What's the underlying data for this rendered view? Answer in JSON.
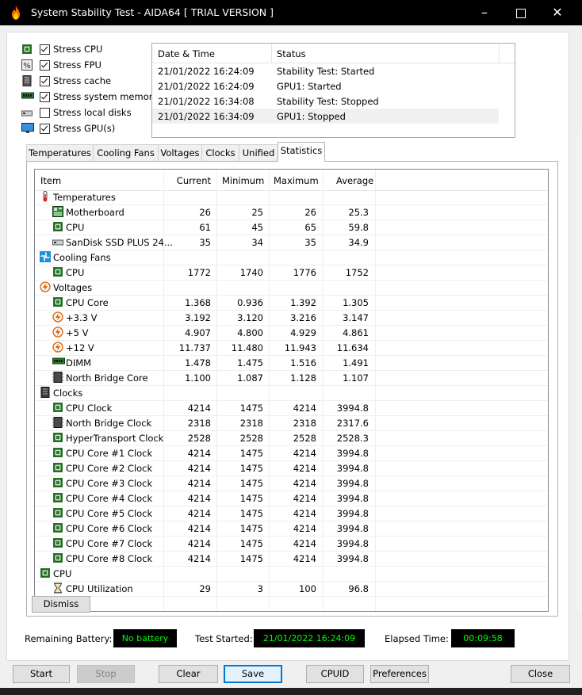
{
  "window": {
    "title": "System Stability Test - AIDA64  [ TRIAL VERSION ]"
  },
  "stress_options": [
    {
      "label": "Stress CPU",
      "checked": true,
      "icon": "cpu-chip-icon"
    },
    {
      "label": "Stress FPU",
      "checked": true,
      "icon": "fpu-percent-icon"
    },
    {
      "label": "Stress cache",
      "checked": true,
      "icon": "cache-icon"
    },
    {
      "label": "Stress system memory",
      "checked": true,
      "icon": "memory-icon"
    },
    {
      "label": "Stress local disks",
      "checked": false,
      "icon": "disk-icon"
    },
    {
      "label": "Stress GPU(s)",
      "checked": true,
      "icon": "monitor-icon"
    }
  ],
  "log": {
    "columns": [
      "Date & Time",
      "Status"
    ],
    "rows": [
      {
        "time": "21/01/2022 16:24:09",
        "status": "Stability Test: Started"
      },
      {
        "time": "21/01/2022 16:24:09",
        "status": "GPU1: Started"
      },
      {
        "time": "21/01/2022 16:34:08",
        "status": "Stability Test: Stopped"
      },
      {
        "time": "21/01/2022 16:34:09",
        "status": "GPU1: Stopped"
      }
    ]
  },
  "tabs": [
    "Temperatures",
    "Cooling Fans",
    "Voltages",
    "Clocks",
    "Unified",
    "Statistics"
  ],
  "active_tab": "Statistics",
  "stats": {
    "columns": [
      "Item",
      "Current",
      "Minimum",
      "Maximum",
      "Average"
    ],
    "rows": [
      {
        "type": "group",
        "name": "Temperatures",
        "icon": "thermometer-icon"
      },
      {
        "type": "item",
        "name": "Motherboard",
        "icon": "motherboard-icon",
        "current": "26",
        "minimum": "25",
        "maximum": "26",
        "average": "25.3"
      },
      {
        "type": "item",
        "name": "CPU",
        "icon": "cpu-chip-icon",
        "current": "61",
        "minimum": "45",
        "maximum": "65",
        "average": "59.8"
      },
      {
        "type": "item",
        "name": "SanDisk SSD PLUS 24...",
        "icon": "disk-icon",
        "current": "35",
        "minimum": "34",
        "maximum": "35",
        "average": "34.9"
      },
      {
        "type": "group",
        "name": "Cooling Fans",
        "icon": "fan-icon"
      },
      {
        "type": "item",
        "name": "CPU",
        "icon": "cpu-chip-icon",
        "current": "1772",
        "minimum": "1740",
        "maximum": "1776",
        "average": "1752"
      },
      {
        "type": "group",
        "name": "Voltages",
        "icon": "voltage-icon"
      },
      {
        "type": "item",
        "name": "CPU Core",
        "icon": "cpu-chip-icon",
        "current": "1.368",
        "minimum": "0.936",
        "maximum": "1.392",
        "average": "1.305"
      },
      {
        "type": "item",
        "name": "+3.3 V",
        "icon": "voltage-icon",
        "current": "3.192",
        "minimum": "3.120",
        "maximum": "3.216",
        "average": "3.147"
      },
      {
        "type": "item",
        "name": "+5 V",
        "icon": "voltage-icon",
        "current": "4.907",
        "minimum": "4.800",
        "maximum": "4.929",
        "average": "4.861"
      },
      {
        "type": "item",
        "name": "+12 V",
        "icon": "voltage-icon",
        "current": "11.737",
        "minimum": "11.480",
        "maximum": "11.943",
        "average": "11.634"
      },
      {
        "type": "item",
        "name": "DIMM",
        "icon": "memory-icon",
        "current": "1.478",
        "minimum": "1.475",
        "maximum": "1.516",
        "average": "1.491"
      },
      {
        "type": "item",
        "name": "North Bridge Core",
        "icon": "chipset-icon",
        "current": "1.100",
        "minimum": "1.087",
        "maximum": "1.128",
        "average": "1.107"
      },
      {
        "type": "group",
        "name": "Clocks",
        "icon": "clock-chip-icon"
      },
      {
        "type": "item",
        "name": "CPU Clock",
        "icon": "cpu-chip-icon",
        "current": "4214",
        "minimum": "1475",
        "maximum": "4214",
        "average": "3994.8"
      },
      {
        "type": "item",
        "name": "North Bridge Clock",
        "icon": "chipset-icon",
        "current": "2318",
        "minimum": "2318",
        "maximum": "2318",
        "average": "2317.6"
      },
      {
        "type": "item",
        "name": "HyperTransport Clock",
        "icon": "cpu-chip-icon",
        "current": "2528",
        "minimum": "2528",
        "maximum": "2528",
        "average": "2528.3"
      },
      {
        "type": "item",
        "name": "CPU Core #1 Clock",
        "icon": "cpu-chip-icon",
        "current": "4214",
        "minimum": "1475",
        "maximum": "4214",
        "average": "3994.8"
      },
      {
        "type": "item",
        "name": "CPU Core #2 Clock",
        "icon": "cpu-chip-icon",
        "current": "4214",
        "minimum": "1475",
        "maximum": "4214",
        "average": "3994.8"
      },
      {
        "type": "item",
        "name": "CPU Core #3 Clock",
        "icon": "cpu-chip-icon",
        "current": "4214",
        "minimum": "1475",
        "maximum": "4214",
        "average": "3994.8"
      },
      {
        "type": "item",
        "name": "CPU Core #4 Clock",
        "icon": "cpu-chip-icon",
        "current": "4214",
        "minimum": "1475",
        "maximum": "4214",
        "average": "3994.8"
      },
      {
        "type": "item",
        "name": "CPU Core #5 Clock",
        "icon": "cpu-chip-icon",
        "current": "4214",
        "minimum": "1475",
        "maximum": "4214",
        "average": "3994.8"
      },
      {
        "type": "item",
        "name": "CPU Core #6 Clock",
        "icon": "cpu-chip-icon",
        "current": "4214",
        "minimum": "1475",
        "maximum": "4214",
        "average": "3994.8"
      },
      {
        "type": "item",
        "name": "CPU Core #7 Clock",
        "icon": "cpu-chip-icon",
        "current": "4214",
        "minimum": "1475",
        "maximum": "4214",
        "average": "3994.8"
      },
      {
        "type": "item",
        "name": "CPU Core #8 Clock",
        "icon": "cpu-chip-icon",
        "current": "4214",
        "minimum": "1475",
        "maximum": "4214",
        "average": "3994.8"
      },
      {
        "type": "group",
        "name": "CPU",
        "icon": "cpu-chip-icon"
      },
      {
        "type": "item",
        "name": "CPU Utilization",
        "icon": "hourglass-icon",
        "current": "29",
        "minimum": "3",
        "maximum": "100",
        "average": "96.8"
      }
    ]
  },
  "dismiss_label": "Dismiss",
  "status": {
    "battery_label": "Remaining Battery:",
    "battery_value": "No battery",
    "started_label": "Test Started:",
    "started_value": "21/01/2022 16:24:09",
    "elapsed_label": "Elapsed Time:",
    "elapsed_value": "00:09:58"
  },
  "buttons": {
    "start": "Start",
    "stop": "Stop",
    "clear": "Clear",
    "save": "Save",
    "cpuid": "CPUID",
    "preferences": "Preferences",
    "close": "Close"
  },
  "colors": {
    "status_text": "#00ff00",
    "status_bg": "#000000",
    "default_button_border": "#0078d7"
  }
}
